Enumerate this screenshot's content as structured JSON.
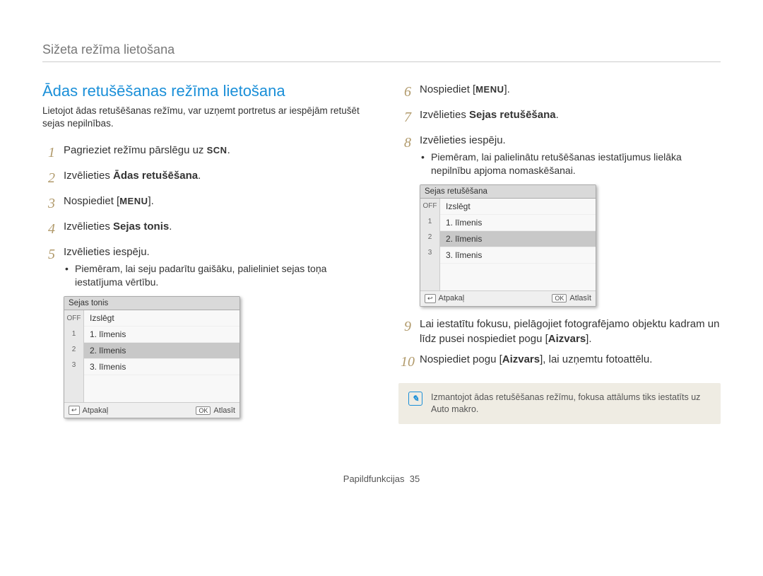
{
  "breadcrumb": "Sižeta režīma lietošana",
  "section_title": "Ādas retušēšanas režīma lietošana",
  "intro": "Lietojot ādas retušēšanas režīmu, var uzņemt portretus ar iespējām retušēt sejas nepilnības.",
  "icons": {
    "scn": "SCN",
    "menu": "MENU",
    "back": "↩",
    "ok": "OK"
  },
  "steps_left": [
    {
      "n": "1",
      "prefix": "Pagrieziet režīmu pārslēgu uz ",
      "icon": "scn",
      "suffix": "."
    },
    {
      "n": "2",
      "prefix": "Izvēlieties ",
      "bold": "Ādas retušēšana",
      "suffix": "."
    },
    {
      "n": "3",
      "prefix": "Nospiediet [",
      "icon": "menu",
      "suffix": "]."
    },
    {
      "n": "4",
      "prefix": "Izvēlieties ",
      "bold": "Sejas tonis",
      "suffix": "."
    },
    {
      "n": "5",
      "prefix": "Izvēlieties iespēju.",
      "bullets": [
        "Piemēram, lai seju padarītu gaišāku, palieliniet sejas toņa iestatījuma vērtību."
      ]
    }
  ],
  "steps_right": [
    {
      "n": "6",
      "prefix": "Nospiediet [",
      "icon": "menu",
      "suffix": "]."
    },
    {
      "n": "7",
      "prefix": "Izvēlieties ",
      "bold": "Sejas retušēšana",
      "suffix": "."
    },
    {
      "n": "8",
      "prefix": "Izvēlieties iespēju.",
      "bullets": [
        "Piemēram, lai palielinātu retušēšanas iestatījumus lielāka nepilnību apjoma nomaskēšanai."
      ]
    },
    {
      "n": "9",
      "html": "Lai iestatītu fokusu, pielāgojiet fotografējamo objektu kadram un līdz pusei nospiediet pogu [<b>Aizvars</b>]."
    },
    {
      "n": "10",
      "html": "Nospiediet pogu [<b>Aizvars</b>], lai uzņemtu fotoattēlu."
    }
  ],
  "menu1": {
    "title": "Sejas tonis",
    "icon_labels": [
      "OFF",
      "1",
      "2",
      "3"
    ],
    "items": [
      "Izslēgt",
      "1. līmenis",
      "2. līmenis",
      "3. līmenis"
    ],
    "selected_index": 2,
    "footer_back": "Atpakaļ",
    "footer_select": "Atlasīt"
  },
  "menu2": {
    "title": "Sejas retušēšana",
    "icon_labels": [
      "OFF",
      "1",
      "2",
      "3"
    ],
    "items": [
      "Izslēgt",
      "1. līmenis",
      "2. līmenis",
      "3. līmenis"
    ],
    "selected_index": 2,
    "footer_back": "Atpakaļ",
    "footer_select": "Atlasīt"
  },
  "note": "Izmantojot ādas retušēšanas režīmu, fokusa attālums tiks iestatīts uz Auto makro.",
  "footer_label": "Papildfunkcijas",
  "footer_page": "35"
}
